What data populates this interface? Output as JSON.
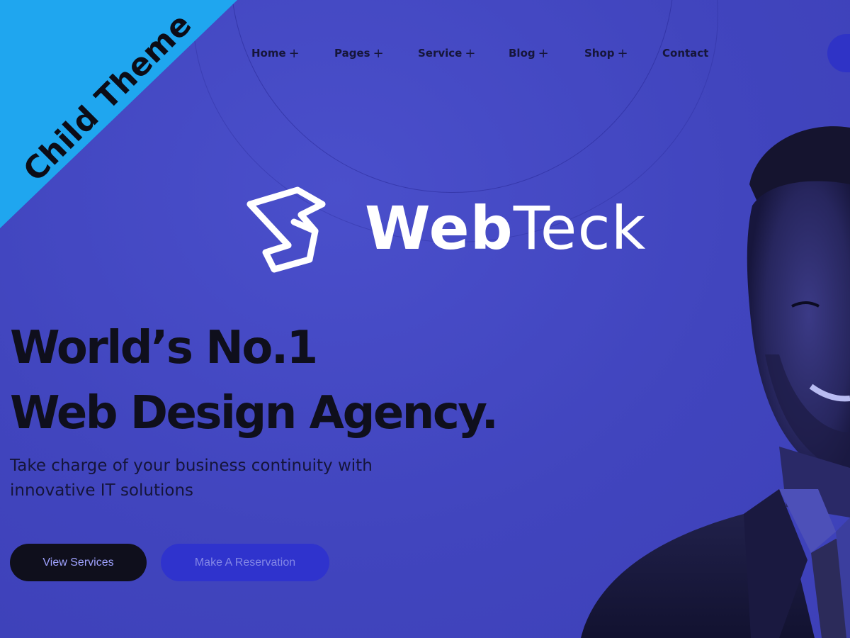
{
  "ribbon": {
    "label": "Child Theme",
    "color": "#1fa6ef"
  },
  "nav": {
    "items": [
      {
        "label": "Home",
        "has_submenu": true
      },
      {
        "label": "Pages",
        "has_submenu": true
      },
      {
        "label": "Service",
        "has_submenu": true
      },
      {
        "label": "Blog",
        "has_submenu": true
      },
      {
        "label": "Shop",
        "has_submenu": true
      },
      {
        "label": "Contact",
        "has_submenu": false
      }
    ],
    "submenu_symbol": "+"
  },
  "logo": {
    "text_bold": "Web",
    "text_light": "Teck"
  },
  "hero": {
    "headline_line1": "World’s No.1",
    "headline_line2": "Web Design Agency.",
    "subtext_line1": "Take charge of your business continuity with",
    "subtext_line2": "innovative IT solutions",
    "primary_button": "View Services",
    "secondary_button": "Make A Reservation"
  },
  "colors": {
    "background": "#4347c0",
    "accent": "#2f33cd",
    "dark": "#0f0f1c"
  }
}
